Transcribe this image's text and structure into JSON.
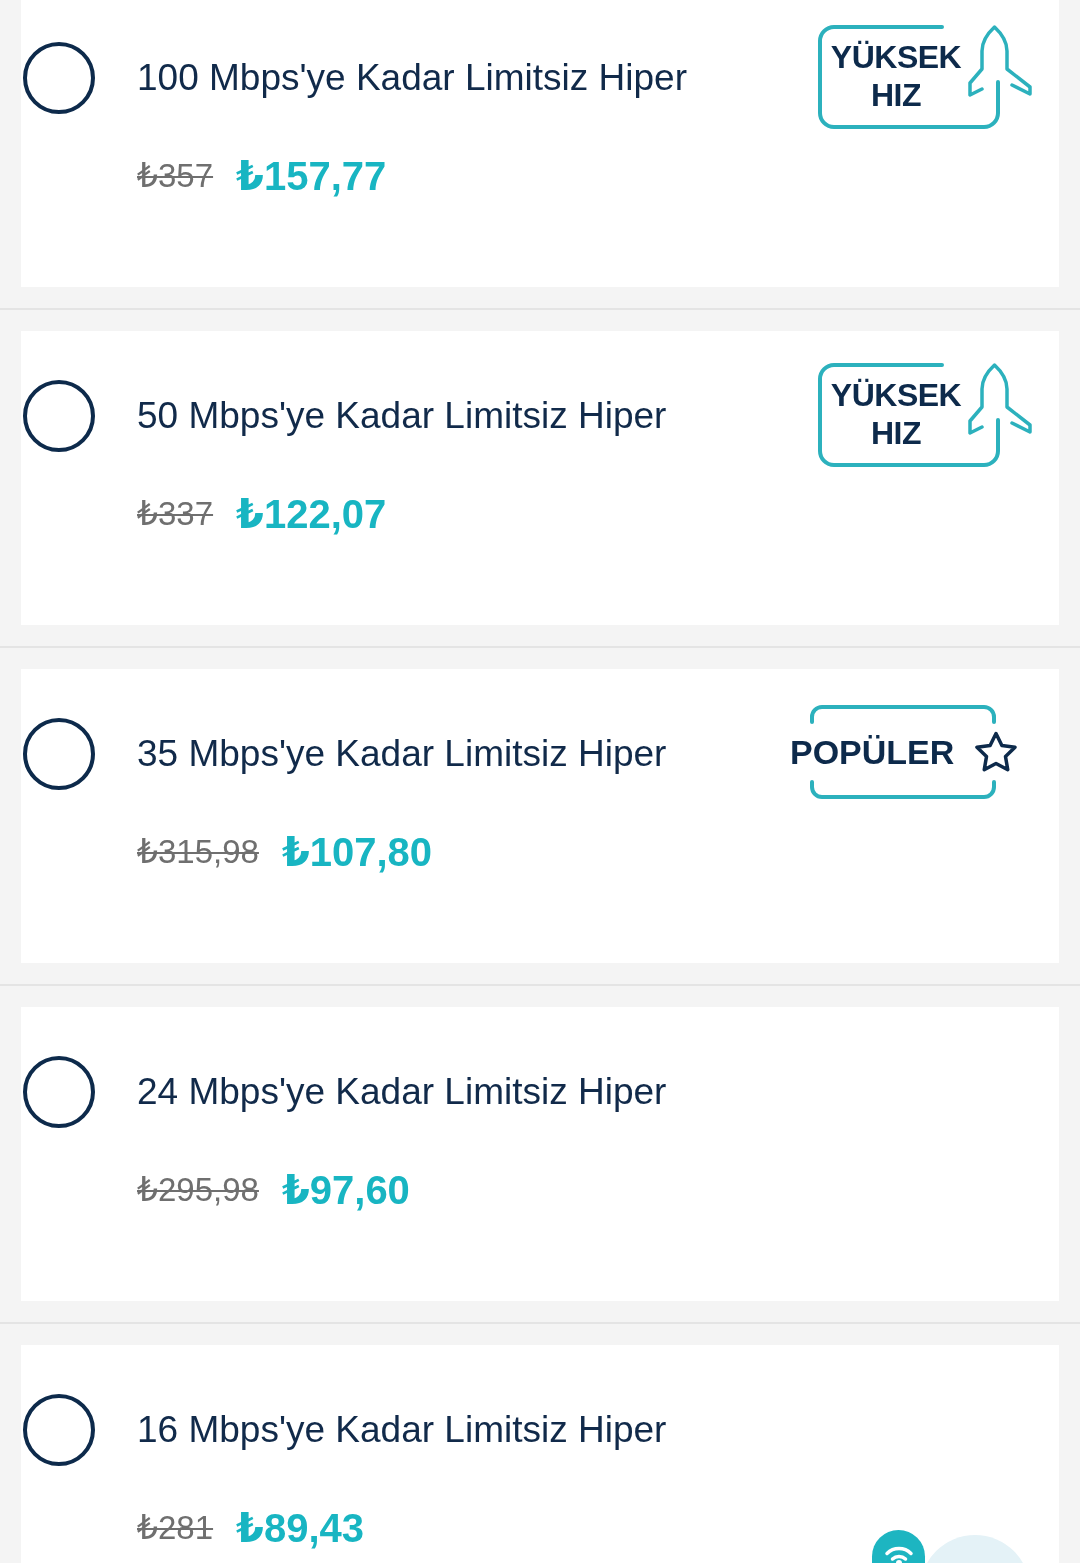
{
  "plans": [
    {
      "title": "100 Mbps'ye Kadar Limitsiz Hiper",
      "selected": false,
      "old_price": "₺357",
      "price": "₺157,77",
      "badge": {
        "kind": "speed",
        "text": "YÜKSEK HIZ"
      }
    },
    {
      "title": "50 Mbps'ye Kadar Limitsiz Hiper",
      "selected": false,
      "old_price": "₺337",
      "price": "₺122,07",
      "badge": {
        "kind": "speed",
        "text": "YÜKSEK HIZ"
      }
    },
    {
      "title": "35 Mbps'ye Kadar Limitsiz Hiper",
      "selected": false,
      "old_price": "₺315,98",
      "price": "₺107,80",
      "badge": {
        "kind": "popular",
        "text": "POPÜLER"
      }
    },
    {
      "title": "24 Mbps'ye Kadar Limitsiz Hiper",
      "selected": false,
      "old_price": "₺295,98",
      "price": "₺97,60"
    },
    {
      "title": "16 Mbps'ye Kadar Limitsiz Hiper",
      "selected": false,
      "old_price": "₺281",
      "price": "₺89,43"
    }
  ]
}
